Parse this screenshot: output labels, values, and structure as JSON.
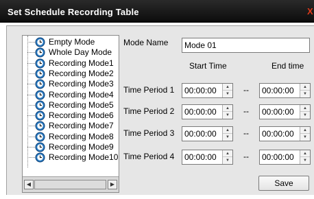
{
  "window": {
    "title": "Set Schedule Recording Table",
    "close_label": "X"
  },
  "tree": {
    "items": [
      {
        "label": "Empty Mode",
        "icon": "mode-icon"
      },
      {
        "label": "Whole Day Mode",
        "icon": "mode-icon"
      },
      {
        "label": "Recording Mode1",
        "icon": "mode-icon"
      },
      {
        "label": "Recording Mode2",
        "icon": "mode-icon"
      },
      {
        "label": "Recording Mode3",
        "icon": "mode-icon"
      },
      {
        "label": "Recording Mode4",
        "icon": "mode-icon"
      },
      {
        "label": "Recording Mode5",
        "icon": "mode-icon"
      },
      {
        "label": "Recording Mode6",
        "icon": "mode-icon"
      },
      {
        "label": "Recording Mode7",
        "icon": "mode-icon"
      },
      {
        "label": "Recording Mode8",
        "icon": "mode-icon"
      },
      {
        "label": "Recording Mode9",
        "icon": "mode-icon"
      },
      {
        "label": "Recording Mode10",
        "icon": "mode-icon"
      }
    ],
    "selected_index": 2
  },
  "form": {
    "mode_name_label": "Mode Name",
    "mode_name_value": "Mode 01",
    "start_time_header": "Start Time",
    "end_time_header": "End time",
    "separator": "--",
    "periods": [
      {
        "label": "Time Period 1",
        "start": "00:00:00",
        "end": "00:00:00"
      },
      {
        "label": "Time Period 2",
        "start": "00:00:00",
        "end": "00:00:00"
      },
      {
        "label": "Time Period 3",
        "start": "00:00:00",
        "end": "00:00:00"
      },
      {
        "label": "Time Period 4",
        "start": "00:00:00",
        "end": "00:00:00"
      }
    ],
    "save_label": "Save"
  },
  "colors": {
    "titlebar": "#111111",
    "close": "#e03a1a",
    "panel": "#e6e6e6",
    "icon_blue": "#2b7cc4"
  }
}
